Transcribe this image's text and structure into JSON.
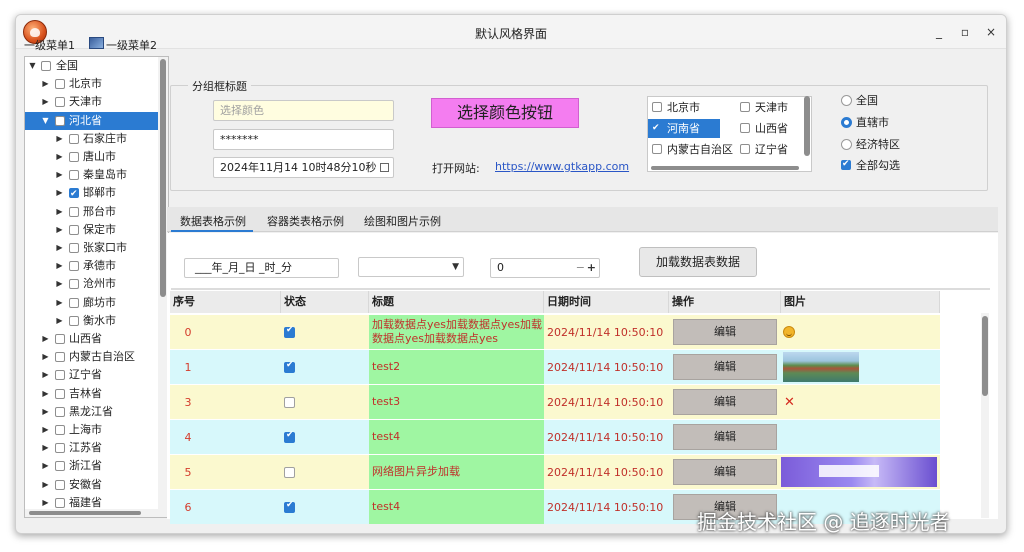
{
  "window": {
    "title": "默认风格界面",
    "min": "_",
    "max": "▫",
    "close": "×"
  },
  "menu": {
    "item1": "一级菜单1",
    "item2": "一级菜单2"
  },
  "tree": {
    "root": "全国",
    "rows": [
      {
        "label": "北京市",
        "level": 1,
        "expander": "closed",
        "checked": false
      },
      {
        "label": "天津市",
        "level": 1,
        "expander": "closed",
        "checked": false
      },
      {
        "label": "河北省",
        "level": 1,
        "expander": "open",
        "checked": false,
        "selected": true
      },
      {
        "label": "石家庄市",
        "level": 2,
        "expander": "closed",
        "checked": false
      },
      {
        "label": "唐山市",
        "level": 2,
        "expander": "closed",
        "checked": false
      },
      {
        "label": "秦皇岛市",
        "level": 2,
        "expander": "closed",
        "checked": false
      },
      {
        "label": "邯郸市",
        "level": 2,
        "expander": "closed",
        "checked": true
      },
      {
        "label": "邢台市",
        "level": 2,
        "expander": "closed",
        "checked": false
      },
      {
        "label": "保定市",
        "level": 2,
        "expander": "closed",
        "checked": false
      },
      {
        "label": "张家口市",
        "level": 2,
        "expander": "closed",
        "checked": false
      },
      {
        "label": "承德市",
        "level": 2,
        "expander": "closed",
        "checked": false
      },
      {
        "label": "沧州市",
        "level": 2,
        "expander": "closed",
        "checked": false
      },
      {
        "label": "廊坊市",
        "level": 2,
        "expander": "closed",
        "checked": false
      },
      {
        "label": "衡水市",
        "level": 2,
        "expander": "closed",
        "checked": false
      },
      {
        "label": "山西省",
        "level": 1,
        "expander": "closed",
        "checked": false
      },
      {
        "label": "内蒙古自治区",
        "level": 1,
        "expander": "closed",
        "checked": false
      },
      {
        "label": "辽宁省",
        "level": 1,
        "expander": "closed",
        "checked": false
      },
      {
        "label": "吉林省",
        "level": 1,
        "expander": "closed",
        "checked": false
      },
      {
        "label": "黑龙江省",
        "level": 1,
        "expander": "closed",
        "checked": false
      },
      {
        "label": "上海市",
        "level": 1,
        "expander": "closed",
        "checked": false
      },
      {
        "label": "江苏省",
        "level": 1,
        "expander": "closed",
        "checked": false
      },
      {
        "label": "浙江省",
        "level": 1,
        "expander": "closed",
        "checked": false
      },
      {
        "label": "安徽省",
        "level": 1,
        "expander": "closed",
        "checked": false
      },
      {
        "label": "福建省",
        "level": 1,
        "expander": "closed",
        "checked": false
      }
    ]
  },
  "group": {
    "title": "分组框标题",
    "color_placeholder": "选择颜色",
    "password": "*******",
    "datetime": "2024年11月14 10时48分10秒",
    "color_button": "选择颜色按钮",
    "site_label": "打开网站:",
    "site_url": "https://www.gtkapp.com",
    "provinces": [
      {
        "label": "北京市",
        "checked": false,
        "selected": false
      },
      {
        "label": "天津市",
        "checked": false,
        "selected": false
      },
      {
        "label": "河南省",
        "checked": true,
        "selected": true
      },
      {
        "label": "山西省",
        "checked": false,
        "selected": false
      },
      {
        "label": "内蒙古自治区",
        "checked": false,
        "selected": false
      },
      {
        "label": "辽宁省",
        "checked": false,
        "selected": false
      }
    ],
    "radios": [
      {
        "label": "全国",
        "on": false
      },
      {
        "label": "直辖市",
        "on": true
      },
      {
        "label": "经济特区",
        "on": false
      }
    ],
    "select_all": "全部勾选"
  },
  "tabs": [
    "数据表格示例",
    "容器类表格示例",
    "绘图和图片示例"
  ],
  "toolbar": {
    "datetime_placeholder": "___年_月_日 _时_分",
    "spin_value": "0",
    "spin_minus": "−",
    "spin_plus": "+",
    "load_button": "加载数据表数据"
  },
  "table": {
    "headers": [
      "序号",
      "状态",
      "标题",
      "日期时间",
      "操作",
      "图片"
    ],
    "rows": [
      {
        "id": "0",
        "checked": true,
        "title": "加载数据点yes加载数据点yes加载数据点yes加载数据点yes",
        "date": "2024/11/14 10:50:10",
        "action": "编辑",
        "image": "emoji-icon",
        "bg": "#fbf9cf"
      },
      {
        "id": "1",
        "checked": true,
        "title": "test2",
        "date": "2024/11/14 10:50:10",
        "action": "编辑",
        "image": "landscape-image",
        "bg": "#d7f8fb"
      },
      {
        "id": "3",
        "checked": false,
        "title": "test3",
        "date": "2024/11/14 10:50:10",
        "action": "编辑",
        "image": "broken-image-icon",
        "bg": "#fbf9cf"
      },
      {
        "id": "4",
        "checked": true,
        "title": "test4",
        "date": "2024/11/14 10:50:10",
        "action": "编辑",
        "image": "",
        "bg": "#d7f8fb"
      },
      {
        "id": "5",
        "checked": false,
        "title": "网络图片异步加载",
        "date": "2024/11/14 10:50:10",
        "action": "编辑",
        "image": "banner-image",
        "bg": "#fbf9cf"
      },
      {
        "id": "6",
        "checked": true,
        "title": "test4",
        "date": "2024/11/14 10:50:10",
        "action": "编辑",
        "image": "",
        "bg": "#d7f8fb"
      }
    ]
  },
  "watermark": "掘金技术社区 @ 追逐时光者"
}
